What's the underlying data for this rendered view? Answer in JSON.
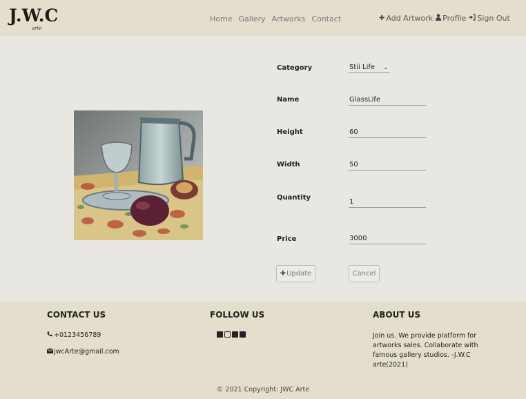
{
  "header": {
    "logo": "J.W.C",
    "logo_sub": "arte",
    "nav": [
      "Home",
      "Gallery",
      "Artworks",
      "Contact"
    ],
    "actions": {
      "add_artwork": "Add Artwork",
      "profile": "Profile",
      "sign_out": "Sign Out"
    }
  },
  "form": {
    "category_label": "Category",
    "category_value": "Stii Life",
    "name_label": "Name",
    "name_value": "GlassLife",
    "height_label": "Height",
    "height_value": "60",
    "width_label": "Width",
    "width_value": "50",
    "quantity_label": "Quantity",
    "quantity_value": "1",
    "price_label": "Price",
    "price_value": "3000",
    "update_label": "Update",
    "cancel_label": "Cancel"
  },
  "footer": {
    "contact_heading": "CONTACT US",
    "phone": "+0123456789",
    "email": "jwcArte@gmail.com",
    "follow_heading": "FOLLOW US",
    "about_heading": "ABOUT US",
    "about_text": "Join us. We provide platform for artworks sales. Collaborate with famous gallery studios. -J.W.C arte(2021)",
    "copyright": "© 2021 Copyright: JWC Arte"
  },
  "icons": [
    "plus-icon",
    "user-icon",
    "sign-out-icon",
    "phone-icon",
    "envelope-icon",
    "facebook-icon",
    "instagram-icon",
    "linkedin-icon",
    "twitter-icon"
  ]
}
